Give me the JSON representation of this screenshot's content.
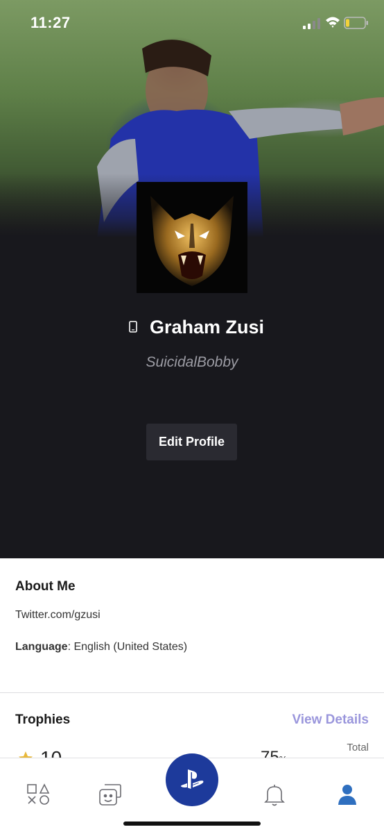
{
  "status_bar": {
    "time": "11:27"
  },
  "profile": {
    "display_name": "Graham Zusi",
    "online_id": "SuicidalBobby",
    "edit_button_label": "Edit Profile"
  },
  "about": {
    "title": "About Me",
    "link_text": "Twitter.com/gzusi",
    "language_label": "Language",
    "language_value": ": English (United States)"
  },
  "trophies": {
    "title": "Trophies",
    "view_details_label": "View Details",
    "total_label": "Total",
    "level": "10",
    "progress": "75"
  },
  "tabbar": {
    "items": [
      {
        "icon": "ps-shapes-icon",
        "active": false
      },
      {
        "icon": "friends-icon",
        "active": false
      },
      {
        "icon": "playstation-logo-icon",
        "active": false
      },
      {
        "icon": "bell-icon",
        "active": false
      },
      {
        "icon": "profile-icon",
        "active": true
      }
    ],
    "active_color": "#2f6fbf",
    "inactive_color": "#6a6a70"
  },
  "colors": {
    "accent": "#9a96dc",
    "ps_blue": "#1d3a9b",
    "header_bg": "#18181d"
  }
}
